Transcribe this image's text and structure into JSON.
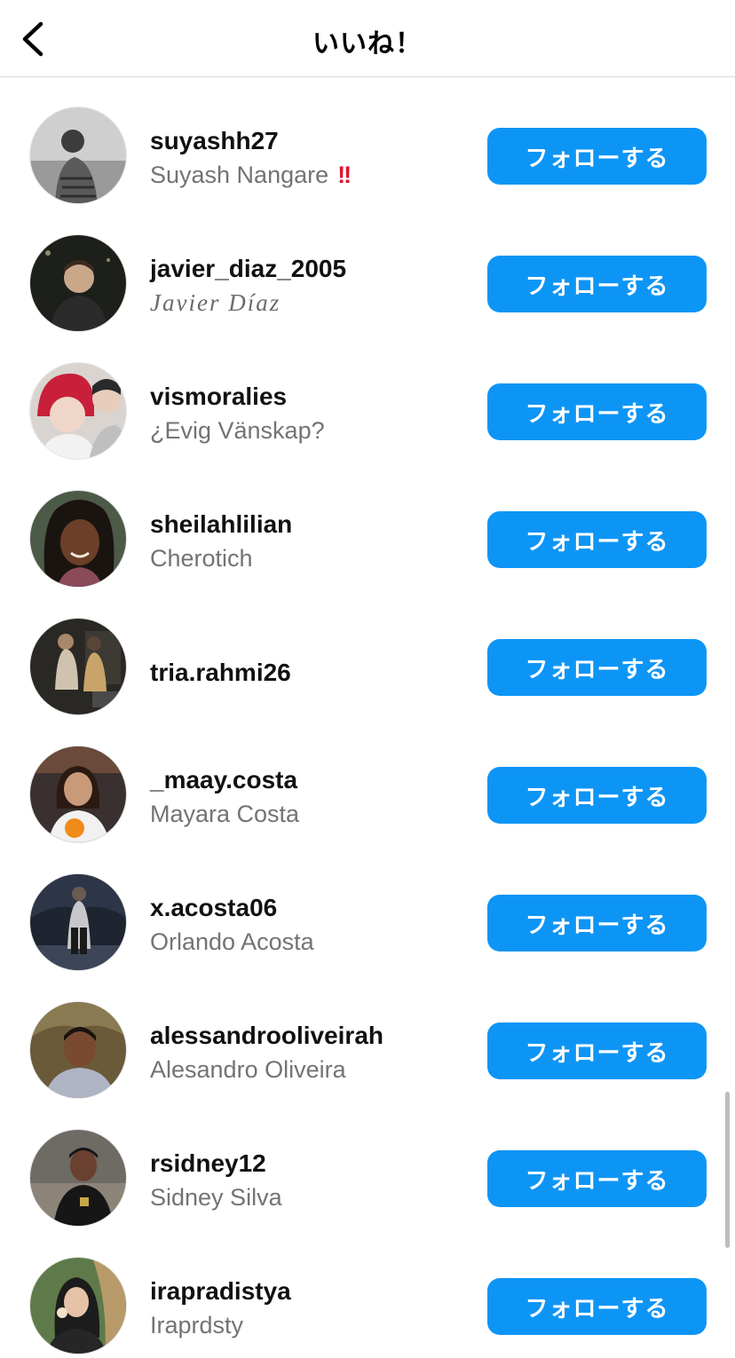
{
  "header": {
    "title": "いいね！",
    "back_icon": "chevron-left-icon"
  },
  "follow_label": "フォローする",
  "accent_color": "#0d95f6",
  "users": [
    {
      "username": "suyashh27",
      "fullname": "Suyash Nangare",
      "mark": "!!"
    },
    {
      "username": "javier_diaz_2005",
      "fullname": "Javier Díaz"
    },
    {
      "username": "vismoralies",
      "fullname": "¿Evig Vänskap?"
    },
    {
      "username": "sheilahlilian",
      "fullname": "Cherotich"
    },
    {
      "username": "tria.rahmi26",
      "fullname": ""
    },
    {
      "username": "_maay.costa",
      "fullname": "Mayara Costa"
    },
    {
      "username": "x.acosta06",
      "fullname": "Orlando Acosta"
    },
    {
      "username": "alessandrooliveirah",
      "fullname": "Alesandro Oliveira"
    },
    {
      "username": "rsidney12",
      "fullname": "Sidney Silva"
    },
    {
      "username": "irapradistya",
      "fullname": "Iraprdsty"
    }
  ]
}
